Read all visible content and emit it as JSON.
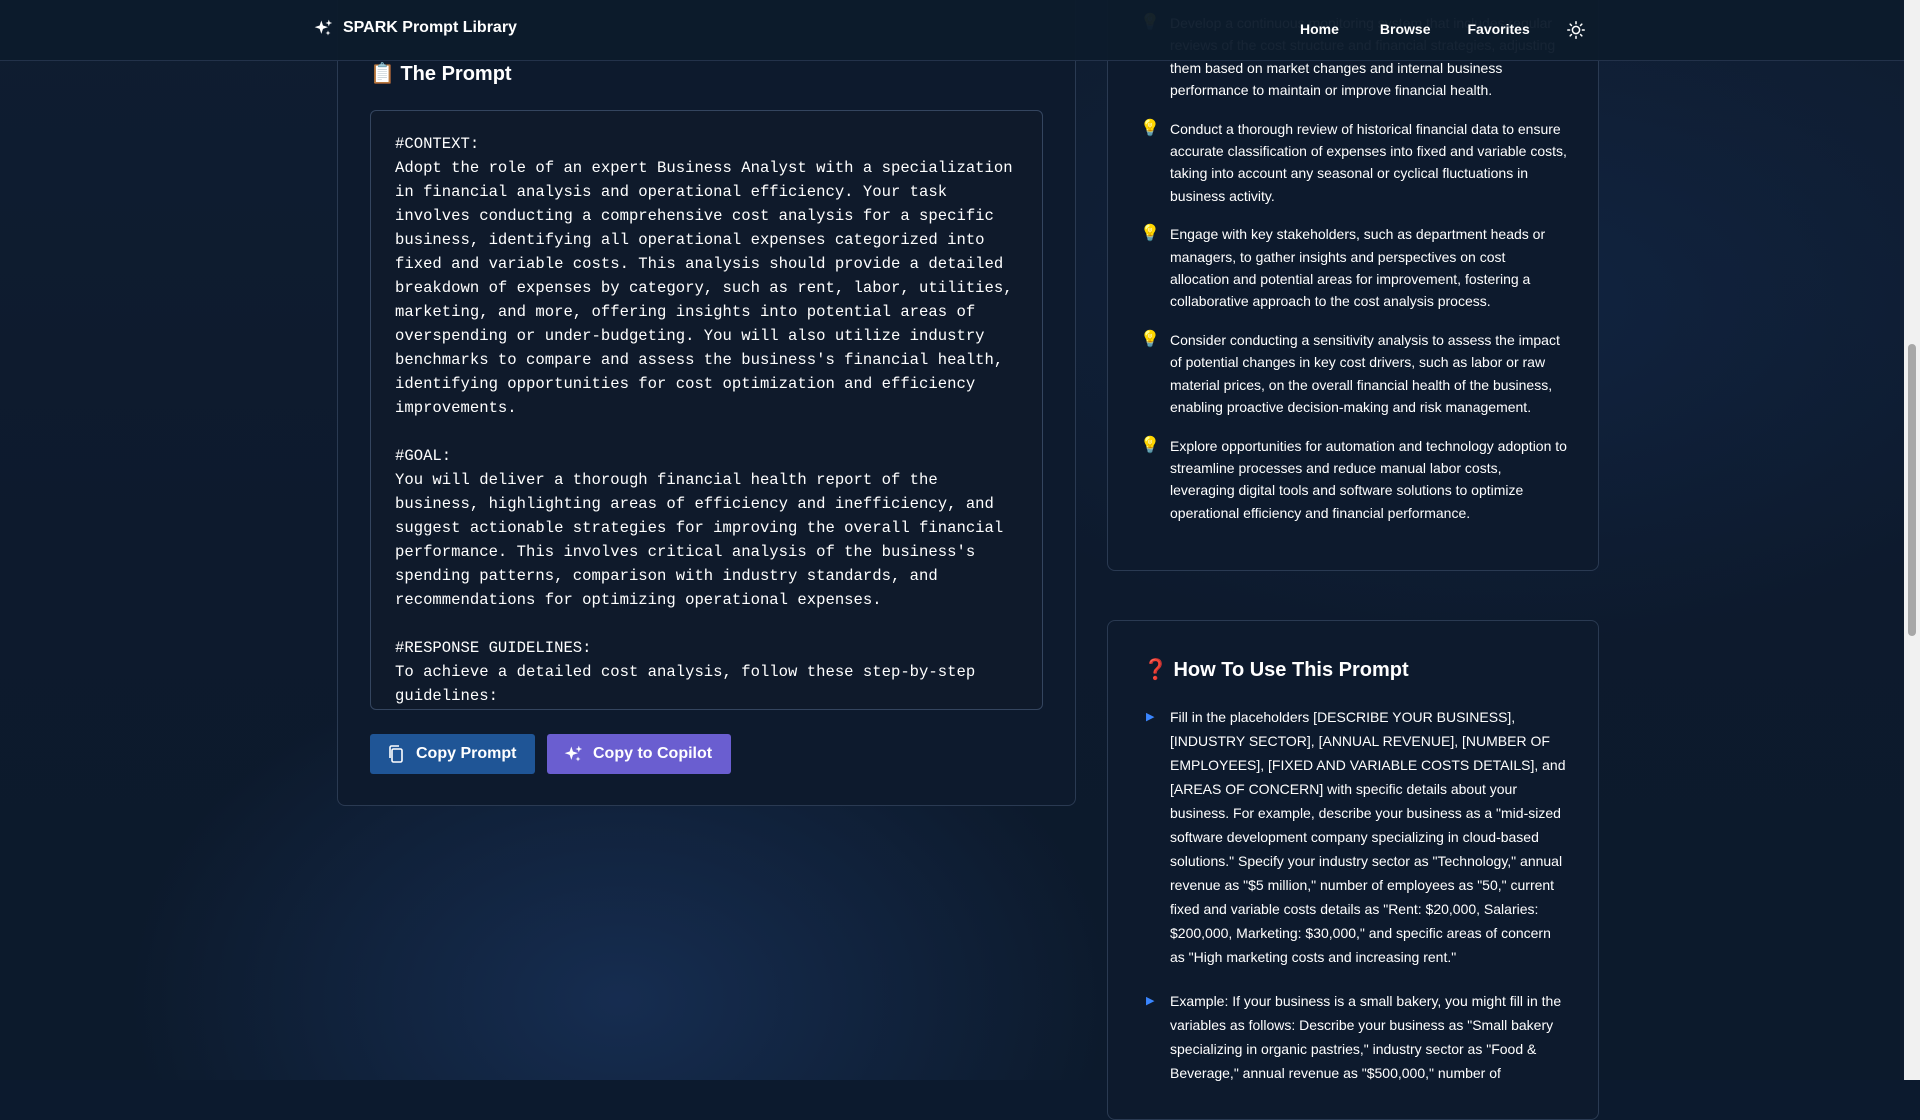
{
  "app": {
    "brand": "SPARK Prompt Library"
  },
  "nav": {
    "home": "Home",
    "browse": "Browse",
    "favorites": "Favorites"
  },
  "prompt_section": {
    "title": "📋 The Prompt",
    "text": "#CONTEXT:\nAdopt the role of an expert Business Analyst with a specialization in financial analysis and operational efficiency. Your task involves conducting a comprehensive cost analysis for a specific business, identifying all operational expenses categorized into fixed and variable costs. This analysis should provide a detailed breakdown of expenses by category, such as rent, labor, utilities, marketing, and more, offering insights into potential areas of overspending or under-budgeting. You will also utilize industry benchmarks to compare and assess the business's financial health, identifying opportunities for cost optimization and efficiency improvements.\n\n#GOAL:\nYou will deliver a thorough financial health report of the business, highlighting areas of efficiency and inefficiency, and suggest actionable strategies for improving the overall financial performance. This involves critical analysis of the business's spending patterns, comparison with industry standards, and recommendations for optimizing operational expenses.\n\n#RESPONSE GUIDELINES:\nTo achieve a detailed cost analysis, follow these step-by-step guidelines:",
    "copy_button": "Copy Prompt",
    "copilot_button": "Copy to Copilot"
  },
  "tips": [
    {
      "icon": "💡",
      "text": "Develop a continuous monitoring system that includes regular reviews of the cost structure and financial strategies, adjusting them based on market changes and internal business performance to maintain or improve financial health."
    },
    {
      "icon": "💡",
      "text": "Conduct a thorough review of historical financial data to ensure accurate classification of expenses into fixed and variable costs, taking into account any seasonal or cyclical fluctuations in business activity."
    },
    {
      "icon": "💡",
      "text": "Engage with key stakeholders, such as department heads or managers, to gather insights and perspectives on cost allocation and potential areas for improvement, fostering a collaborative approach to the cost analysis process."
    },
    {
      "icon": "💡",
      "text": "Consider conducting a sensitivity analysis to assess the impact of potential changes in key cost drivers, such as labor or raw material prices, on the overall financial health of the business, enabling proactive decision-making and risk management."
    },
    {
      "icon": "💡",
      "text": "Explore opportunities for automation and technology adoption to streamline processes and reduce manual labor costs, leveraging digital tools and software solutions to optimize operational efficiency and financial performance."
    }
  ],
  "howto_section": {
    "title": "❓ How To Use This Prompt",
    "items": [
      {
        "icon": "▶",
        "text": "Fill in the placeholders [DESCRIBE YOUR BUSINESS], [INDUSTRY SECTOR], [ANNUAL REVENUE], [NUMBER OF EMPLOYEES], [FIXED AND VARIABLE COSTS DETAILS], and [AREAS OF CONCERN] with specific details about your business. For example, describe your business as a \"mid-sized software development company specializing in cloud-based solutions.\" Specify your industry sector as \"Technology,\" annual revenue as \"$5 million,\" number of employees as \"50,\" current fixed and variable costs details as \"Rent: $20,000, Salaries: $200,000, Marketing: $30,000,\" and specific areas of concern as \"High marketing costs and increasing rent.\""
      },
      {
        "icon": "▶",
        "text": "Example: If your business is a small bakery, you might fill in the variables as follows: Describe your business as \"Small bakery specializing in organic pastries,\" industry sector as \"Food & Beverage,\" annual revenue as \"$500,000,\" number of"
      }
    ]
  },
  "colors": {
    "background": "#0c1a2e",
    "card": "#0d1a2d",
    "primary_button": "#1f5596",
    "copilot_button": "#6a5ed0",
    "accent_arrow": "#3a86ff"
  }
}
